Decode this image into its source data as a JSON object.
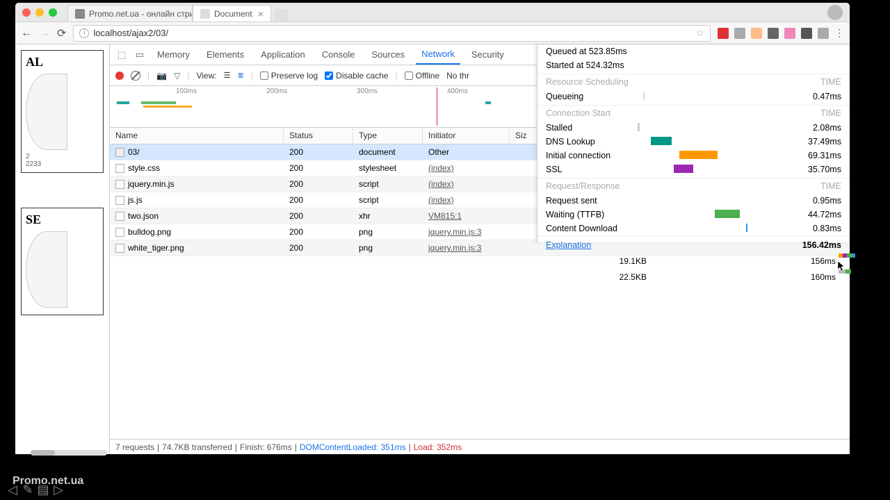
{
  "browser": {
    "tabs": [
      {
        "title": "Promo.net.ua - онлайн стрим",
        "active": false
      },
      {
        "title": "Document",
        "active": true
      }
    ],
    "url": "localhost/ajax2/03/"
  },
  "page": {
    "card1_title": "AL",
    "card1_num1": "2",
    "card1_num2": "2233",
    "card2_title": "SE"
  },
  "devtools": {
    "panels": [
      "Memory",
      "Elements",
      "Application",
      "Console",
      "Sources",
      "Network",
      "Security"
    ],
    "active_panel": "Network",
    "view_label": "View:",
    "preserve_log": "Preserve log",
    "disable_cache": "Disable cache",
    "offline": "Offline",
    "throttle": "No thr",
    "overview_ticks": [
      "100ms",
      "200ms",
      "300ms",
      "400ms"
    ],
    "columns": [
      "Name",
      "Status",
      "Type",
      "Initiator",
      "Siz"
    ],
    "rows": [
      {
        "name": "03/",
        "status": "200",
        "type": "document",
        "initiator": "Other",
        "selected": true,
        "folder": true
      },
      {
        "name": "style.css",
        "status": "200",
        "type": "stylesheet",
        "initiator": "(index)",
        "link": true
      },
      {
        "name": "jquery.min.js",
        "status": "200",
        "type": "script",
        "initiator": "(index)",
        "link": true
      },
      {
        "name": "js.js",
        "status": "200",
        "type": "script",
        "initiator": "(index)",
        "link": true
      },
      {
        "name": "two.json",
        "status": "200",
        "type": "xhr",
        "initiator": "VM815:1",
        "link": true
      },
      {
        "name": "bulldog.png",
        "status": "200",
        "type": "png",
        "initiator": "jquery.min.js:3",
        "link": true
      },
      {
        "name": "white_tiger.png",
        "status": "200",
        "type": "png",
        "initiator": "jquery.min.js:3",
        "link": true
      }
    ],
    "extra": [
      {
        "size": "19.1KB",
        "time": "156ms"
      },
      {
        "size": "22.5KB",
        "time": "160ms"
      }
    ],
    "status": {
      "requests": "7 requests",
      "transferred": "74.7KB transferred",
      "finish": "Finish: 676ms",
      "dom": "DOMContentLoaded: 351ms",
      "load": "Load: 352ms"
    }
  },
  "timing": {
    "queued": "Queued at 523.85ms",
    "started": "Started at 524.32ms",
    "scheduling": "Resource Scheduling",
    "time_hdr": "TIME",
    "queueing": "Queueing",
    "queueing_v": "0.47ms",
    "conn_start": "Connection Start",
    "stalled": "Stalled",
    "stalled_v": "2.08ms",
    "dns": "DNS Lookup",
    "dns_v": "37.49ms",
    "initconn": "Initial connection",
    "initconn_v": "69.31ms",
    "ssl": "SSL",
    "ssl_v": "35.70ms",
    "reqresp": "Request/Response",
    "sent": "Request sent",
    "sent_v": "0.95ms",
    "ttfb": "Waiting (TTFB)",
    "ttfb_v": "44.72ms",
    "dl": "Content Download",
    "dl_v": "0.83ms",
    "explanation": "Explanation",
    "total": "156.42ms"
  },
  "watermark": "Promo.net.ua"
}
